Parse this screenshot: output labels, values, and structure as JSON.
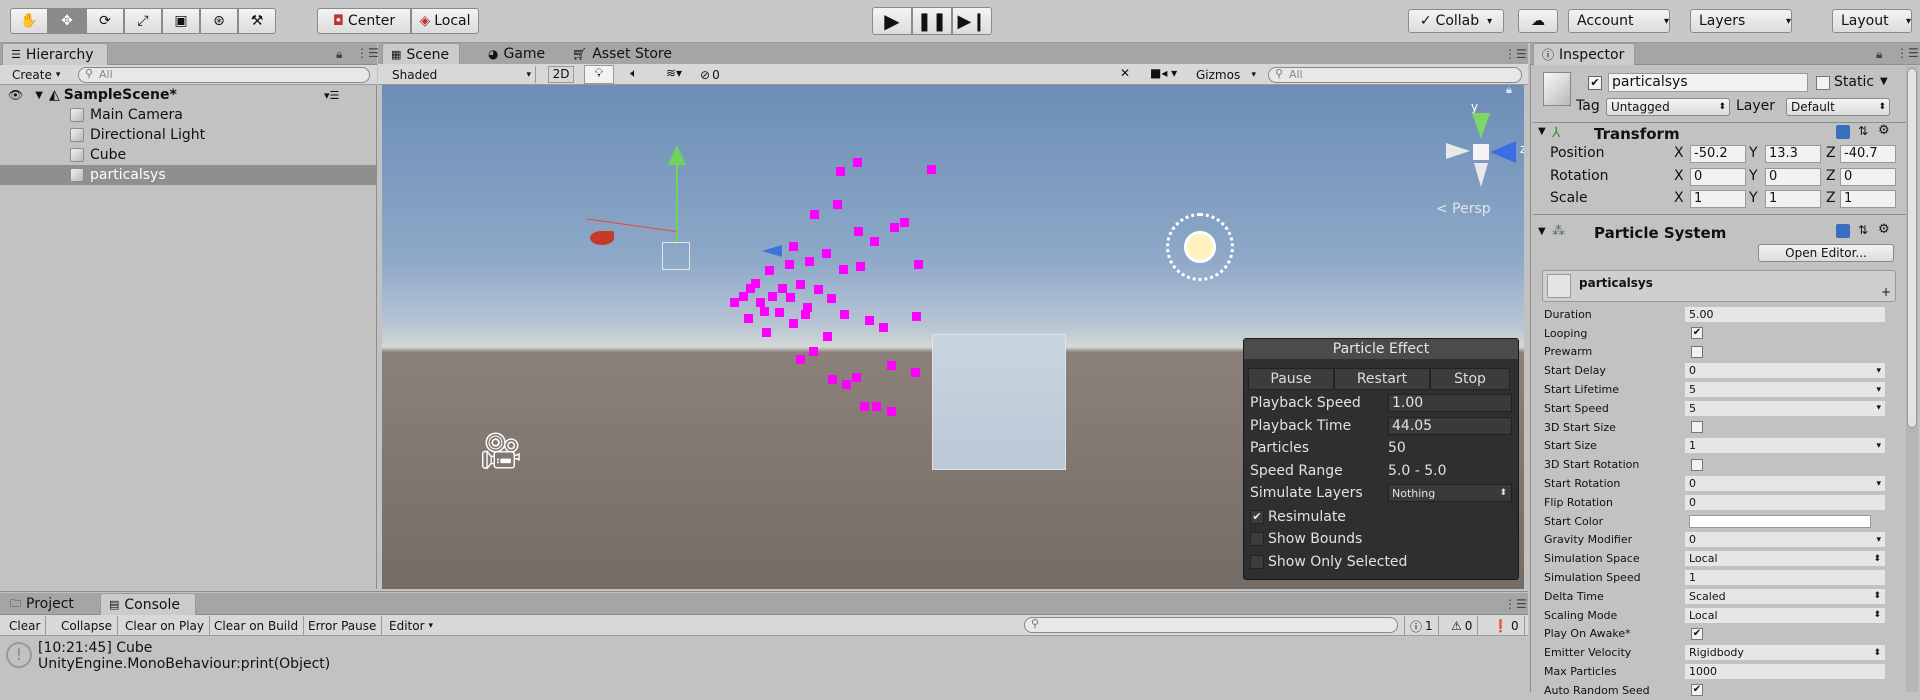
{
  "toolbar": {
    "pivot_center": "Center",
    "pivot_local": "Local",
    "collab": "Collab",
    "account": "Account",
    "layers": "Layers",
    "layout": "Layout"
  },
  "hierarchy": {
    "tab": "Hierarchy",
    "create": "Create",
    "search_placeholder": "All",
    "scene": "SampleScene*",
    "items": [
      {
        "label": "Main Camera"
      },
      {
        "label": "Directional Light"
      },
      {
        "label": "Cube"
      },
      {
        "label": "particalsys"
      }
    ]
  },
  "scene_tabs": {
    "scene": "Scene",
    "game": "Game",
    "asset_store": "Asset Store"
  },
  "scene_toolbar": {
    "shading": "Shaded",
    "mode_2d": "2D",
    "hidden_count": "0",
    "gizmos": "Gizmos",
    "search_placeholder": "All"
  },
  "scene_view": {
    "persp_label": "< Persp",
    "axis_y": "y",
    "axis_z": "z"
  },
  "particle_effect": {
    "title": "Particle Effect",
    "pause": "Pause",
    "restart": "Restart",
    "stop": "Stop",
    "rows": [
      {
        "key": "Playback Speed",
        "value": "1.00"
      },
      {
        "key": "Playback Time",
        "value": "44.05"
      },
      {
        "key": "Particles",
        "value": "50"
      },
      {
        "key": "Speed Range",
        "value": "5.0 - 5.0"
      },
      {
        "key": "Simulate Layers",
        "value": "Nothing"
      }
    ],
    "checks": [
      {
        "label": "Resimulate",
        "checked": true
      },
      {
        "label": "Show Bounds",
        "checked": false
      },
      {
        "label": "Show Only Selected",
        "checked": false
      }
    ]
  },
  "bottom": {
    "project_tab": "Project",
    "console_tab": "Console",
    "clear": "Clear",
    "collapse": "Collapse",
    "clear_on_play": "Clear on Play",
    "clear_on_build": "Clear on Build",
    "error_pause": "Error Pause",
    "editor": "Editor",
    "log_count": "1",
    "warn_count": "0",
    "error_count": "0",
    "log_line1": "[10:21:45] Cube",
    "log_line2": "UnityEngine.MonoBehaviour:print(Object)"
  },
  "inspector": {
    "tab": "Inspector",
    "object_name": "particalsys",
    "static": "Static",
    "tag_label": "Tag",
    "tag_value": "Untagged",
    "layer_label": "Layer",
    "layer_value": "Default",
    "transform": {
      "title": "Transform",
      "position_label": "Position",
      "rotation_label": "Rotation",
      "scale_label": "Scale",
      "x": "X",
      "y": "Y",
      "z": "Z",
      "position": [
        "-50.2",
        "13.3",
        "-40.7"
      ],
      "rotation": [
        "0",
        "0",
        "0"
      ],
      "scale": [
        "1",
        "1",
        "1"
      ]
    },
    "particle_system": {
      "title": "Particle System",
      "open_editor": "Open Editor...",
      "module_name": "particalsys",
      "rows": [
        {
          "label": "Duration",
          "value": "5.00",
          "kind": "box"
        },
        {
          "label": "Looping",
          "kind": "check",
          "checked": true
        },
        {
          "label": "Prewarm",
          "kind": "check",
          "checked": false
        },
        {
          "label": "Start Delay",
          "value": "0",
          "kind": "arrow"
        },
        {
          "label": "Start Lifetime",
          "value": "5",
          "kind": "arrow"
        },
        {
          "label": "Start Speed",
          "value": "5",
          "kind": "arrow"
        },
        {
          "label": "3D Start Size",
          "kind": "check",
          "checked": false
        },
        {
          "label": "Start Size",
          "value": "1",
          "kind": "arrow"
        },
        {
          "label": "3D Start Rotation",
          "kind": "check",
          "checked": false
        },
        {
          "label": "Start Rotation",
          "value": "0",
          "kind": "arrow"
        },
        {
          "label": "Flip Rotation",
          "value": "0",
          "kind": "box"
        },
        {
          "label": "Start Color",
          "kind": "color"
        },
        {
          "label": "Gravity Modifier",
          "value": "0",
          "kind": "arrow"
        },
        {
          "label": "Simulation Space",
          "value": "Local",
          "kind": "sel"
        },
        {
          "label": "Simulation Speed",
          "value": "1",
          "kind": "box"
        },
        {
          "label": "Delta Time",
          "value": "Scaled",
          "kind": "sel"
        },
        {
          "label": "Scaling Mode",
          "value": "Local",
          "kind": "sel"
        },
        {
          "label": "Play On Awake*",
          "kind": "check",
          "checked": true
        },
        {
          "label": "Emitter Velocity",
          "value": "Rigidbody",
          "kind": "sel"
        },
        {
          "label": "Max Particles",
          "value": "1000",
          "kind": "box"
        },
        {
          "label": "Auto Random Seed",
          "kind": "check",
          "checked": true
        }
      ]
    }
  },
  "colors": {
    "particle": "#ff00ff",
    "selection": "#8f8f8f",
    "sky_top": "#6d8fb8",
    "ground": "#6e6560"
  }
}
